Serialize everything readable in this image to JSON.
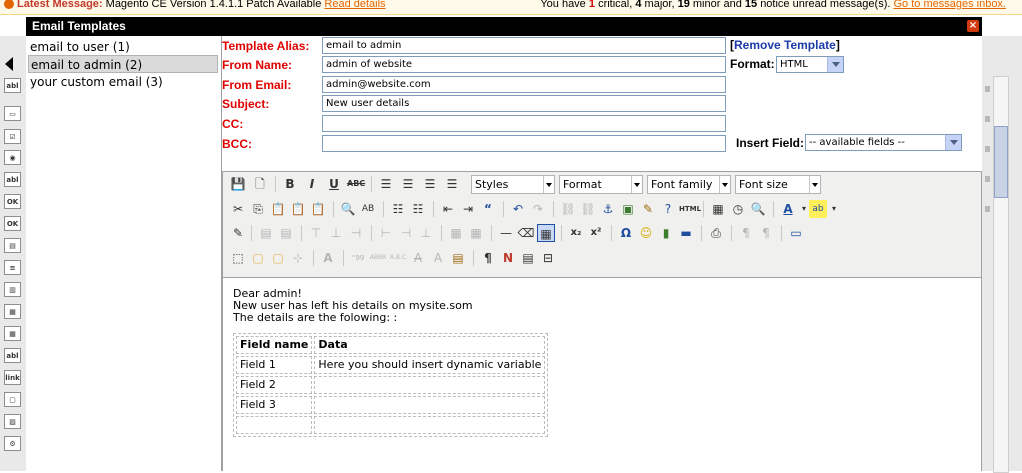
{
  "notice": {
    "label": "Latest Message:",
    "text": "Magento CE Version 1.4.1.1 Patch Available",
    "link": "Read details",
    "pre": "You have",
    "critical_count": "1",
    "critical_label": "critical,",
    "major_count": "4",
    "major_label": "major,",
    "minor_count": "19",
    "minor_label": "minor and",
    "notice_count": "15",
    "notice_label": "notice unread message(s).",
    "inbox_link": "Go to messages inbox."
  },
  "bg_toolbox": [
    "abl",
    "▭",
    "☑",
    "◉",
    "abl",
    "OK",
    "OK",
    "▤",
    "≡",
    "▥",
    "▦",
    "▦",
    "abl",
    "link",
    "▢",
    "▨",
    "⚙"
  ],
  "dialog": {
    "title": "Email Templates",
    "close": "×"
  },
  "templates": [
    {
      "label": "email to user (1)",
      "selected": false
    },
    {
      "label": "email to admin (2)",
      "selected": true
    },
    {
      "label": "your custom email (3)",
      "selected": false
    }
  ],
  "form": {
    "alias_label": "Template Alias:",
    "alias_value": "email to admin",
    "from_name_label": "From Name:",
    "from_name_value": "admin of website",
    "from_email_label": "From Email:",
    "from_email_value": "admin@website.com",
    "subject_label": "Subject:",
    "subject_value": "New user details",
    "cc_label": "CC:",
    "cc_value": "",
    "bcc_label": "BCC:",
    "bcc_value": "",
    "remove_open": "[",
    "remove_label": "Remove Template",
    "remove_close": "]",
    "format_label": "Format:",
    "format_value": "HTML",
    "insert_field_label": "Insert Field:",
    "insert_field_value": "-- available fields --"
  },
  "toolbar": {
    "styles": "Styles",
    "format": "Format",
    "font_family": "Font family",
    "font_size": "Font size"
  },
  "content": {
    "line1": "Dear admin!",
    "line2": "New user has left his details on mysite.som",
    "line3": "The details are the folowing: :",
    "table_header": [
      "Field name",
      "Data"
    ],
    "table_rows": [
      [
        "Field 1",
        "Here you should insert dynamic variable"
      ],
      [
        "Field 2",
        ""
      ],
      [
        "Field 3",
        ""
      ],
      [
        "",
        ""
      ]
    ]
  }
}
